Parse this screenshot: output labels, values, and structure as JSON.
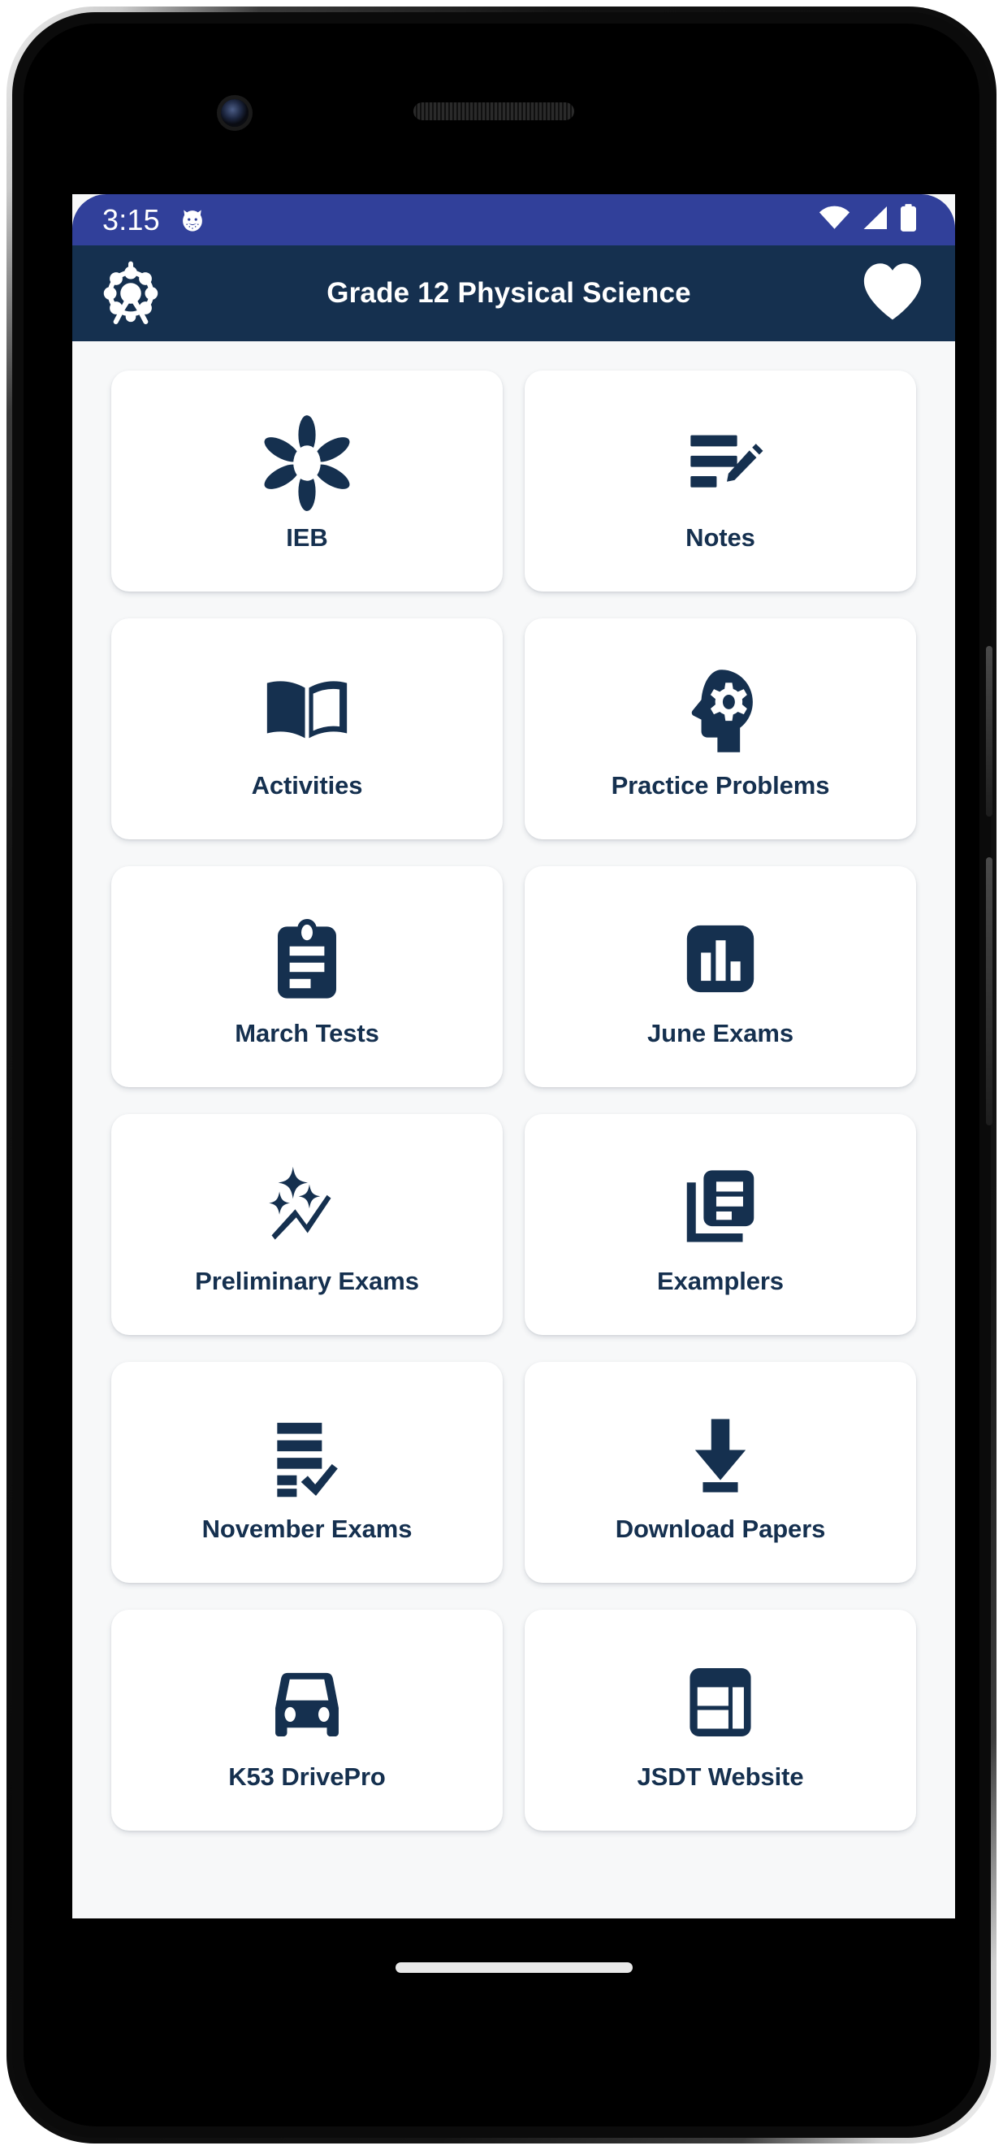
{
  "status_bar": {
    "time": "3:15",
    "notification_icon": "cat-face-icon",
    "wifi_icon": "wifi-icon",
    "signal_icon": "cellular-signal-icon",
    "battery_icon": "battery-full-icon",
    "background_color": "#31409A"
  },
  "app_bar": {
    "logo_icon": "ferris-wheel-logo-icon",
    "title": "Grade 12 Physical Science",
    "favorite_icon": "heart-icon",
    "background_color": "#15304F"
  },
  "theme": {
    "primary": "#15304F",
    "accent": "#31409A",
    "card_background": "#ffffff",
    "page_background": "#f7f8f9"
  },
  "menu": {
    "items": [
      {
        "label": "IEB",
        "icon": "flower-icon"
      },
      {
        "label": "Notes",
        "icon": "note-pencil-icon"
      },
      {
        "label": "Activities",
        "icon": "open-book-icon"
      },
      {
        "label": "Practice Problems",
        "icon": "head-gear-icon"
      },
      {
        "label": "March Tests",
        "icon": "clipboard-icon"
      },
      {
        "label": "June Exams",
        "icon": "bar-chart-icon"
      },
      {
        "label": "Preliminary Exams",
        "icon": "sparkle-trend-icon"
      },
      {
        "label": "Examplers",
        "icon": "library-documents-icon"
      },
      {
        "label": "November Exams",
        "icon": "checklist-icon"
      },
      {
        "label": "Download Papers",
        "icon": "download-icon"
      },
      {
        "label": "K53 DrivePro",
        "icon": "car-icon"
      },
      {
        "label": "JSDT Website",
        "icon": "web-layout-icon"
      }
    ]
  },
  "system_nav": {
    "home_indicator": "home-indicator-bar"
  }
}
